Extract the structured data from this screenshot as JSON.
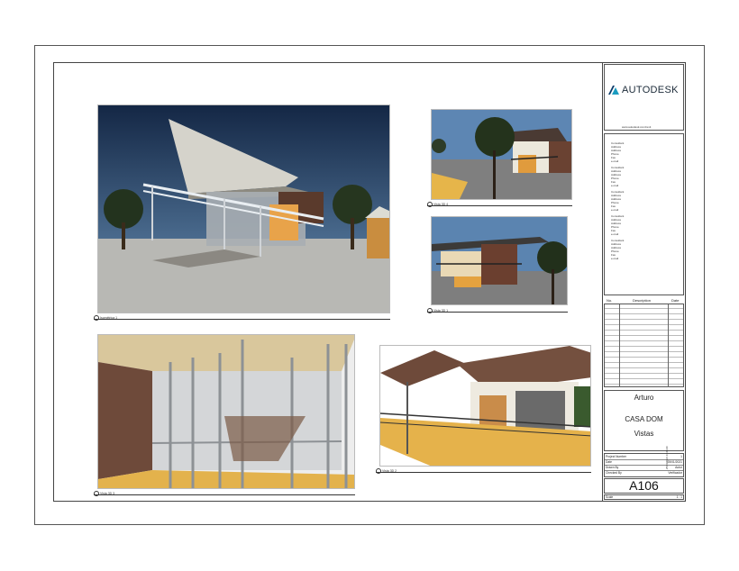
{
  "title_block": {
    "brand": "AUTODESK",
    "website": "www.autodesk.com/revit",
    "consultants": [
      {
        "lines": [
          "Consultant",
          "Address",
          "Address",
          "Phone",
          "Fax",
          "e-mail"
        ]
      },
      {
        "lines": [
          "Consultant",
          "Address",
          "Address",
          "Phone",
          "Fax",
          "e-mail"
        ]
      },
      {
        "lines": [
          "Consultant",
          "Address",
          "Address",
          "Phone",
          "Fax",
          "e-mail"
        ]
      },
      {
        "lines": [
          "Consultant",
          "Address",
          "Address",
          "Phone",
          "Fax",
          "e-mail"
        ]
      },
      {
        "lines": [
          "Consultant",
          "Address",
          "Address",
          "Phone",
          "Fax",
          "e-mail"
        ]
      }
    ],
    "revisions": {
      "headers": {
        "no": "No.",
        "description": "Description",
        "date": "Date"
      }
    },
    "owner": "Arturo",
    "project_name": "CASA DOM",
    "sheet_name": "Vistas",
    "fields": [
      {
        "label": "Project Number",
        "value": "1"
      },
      {
        "label": "Date",
        "value": "25/01/2021"
      },
      {
        "label": "Drawn By",
        "value": "Autor"
      },
      {
        "label": "Checked By",
        "value": "Verificador"
      }
    ],
    "sheet_number": "A106",
    "scale_label": "Scale",
    "scale_value": "1 : 1",
    "side_stamp": "25/01/2021 13:29:40"
  },
  "views": [
    {
      "label": "Isométrica 1"
    },
    {
      "label": "Vista 3D 4"
    },
    {
      "label": "Vista 3D 1"
    },
    {
      "label": "Vista 3D 3"
    },
    {
      "label": "Vista 3D 2"
    }
  ],
  "colors": {
    "autodesk_teal": "#1a9bbf",
    "autodesk_navy": "#0b3d6b",
    "wood_floor": "#e0b24a",
    "night_sky": "#1b2e4e"
  }
}
